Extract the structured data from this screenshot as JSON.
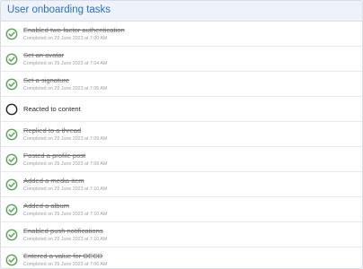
{
  "panel": {
    "title": "User onboarding tasks"
  },
  "colors": {
    "done": "#5aa35a",
    "pending": "#222222",
    "accent": "#2f6fb7"
  },
  "tasks": [
    {
      "title": "Enabled two-factor authentication",
      "meta": "Completed on 29 June 2023 at 7:00 AM",
      "done": true
    },
    {
      "title": "Set an avatar",
      "meta": "Completed on 29 June 2023 at 7:04 AM",
      "done": true
    },
    {
      "title": "Set a signature",
      "meta": "Completed on 29 June 2023 at 7:05 AM",
      "done": true
    },
    {
      "title": "Reacted to content",
      "meta": "",
      "done": false
    },
    {
      "title": "Replied to a thread",
      "meta": "Completed on 29 June 2023 at 7:09 AM",
      "done": true
    },
    {
      "title": "Posted a profile post",
      "meta": "Completed on 29 June 2023 at 7:09 AM",
      "done": true
    },
    {
      "title": "Added a media item",
      "meta": "Completed on 29 June 2023 at 7:10 AM",
      "done": true
    },
    {
      "title": "Added a album",
      "meta": "Completed on 29 June 2023 at 7:10 AM",
      "done": true
    },
    {
      "title": "Enabled push notifications",
      "meta": "Completed on 29 June 2023 at 7:10 AM",
      "done": true
    },
    {
      "title": "Entered a value for OECD",
      "meta": "Completed on 29 June 2023 at 7:06 AM",
      "done": true
    }
  ]
}
